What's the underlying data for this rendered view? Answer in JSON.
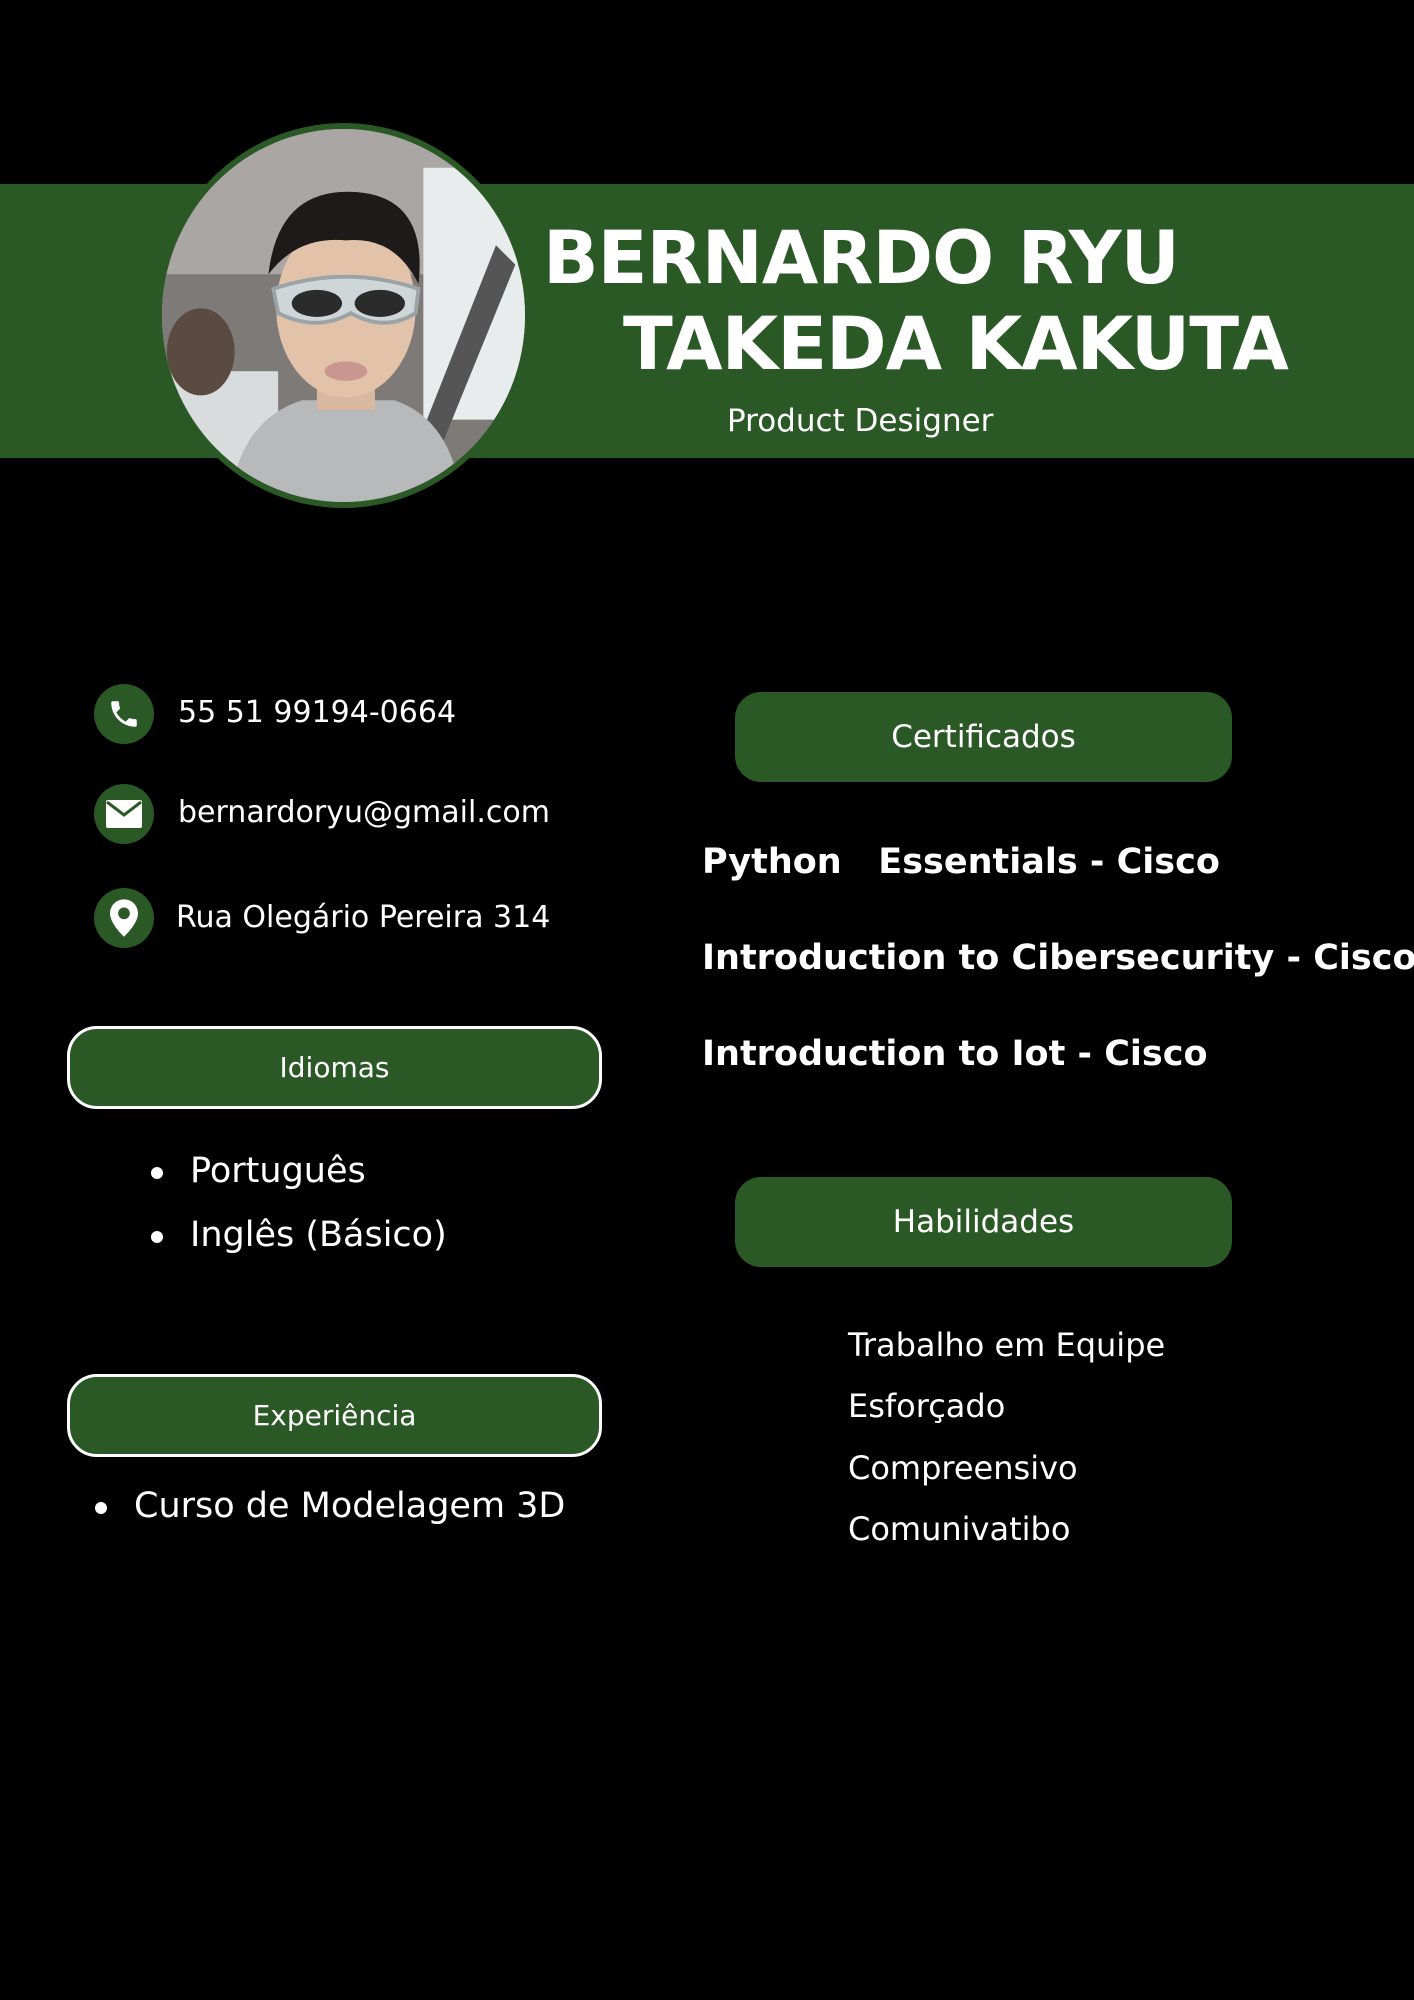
{
  "header": {
    "name_line_1": "BERNARDO RYU",
    "name_line_2": "TAKEDA KAKUTA",
    "role": "Product Designer"
  },
  "contact": {
    "phone": "55 51 99194-0664",
    "email": "bernardoryu@gmail.com",
    "address": "Rua Olegário Pereira 314"
  },
  "languages": {
    "heading": "Idiomas",
    "items": [
      "Português",
      "Inglês (Básico)"
    ]
  },
  "experience": {
    "heading": "Experiência",
    "items": [
      "Curso de Modelagem 3D"
    ]
  },
  "certificates": {
    "heading": "Certificados",
    "items": [
      "Python   Essentials - Cisco",
      "Introduction to Cibersecurity - Cisco",
      "Introduction to Iot - Cisco"
    ]
  },
  "skills": {
    "heading": "Habilidades",
    "items": [
      "Trabalho em Equipe",
      "Esforçado",
      "Compreensivo",
      "Comunivatibo"
    ]
  },
  "colors": {
    "background": "#000000",
    "accent_green": "#2a5926",
    "text": "#ffffff"
  }
}
